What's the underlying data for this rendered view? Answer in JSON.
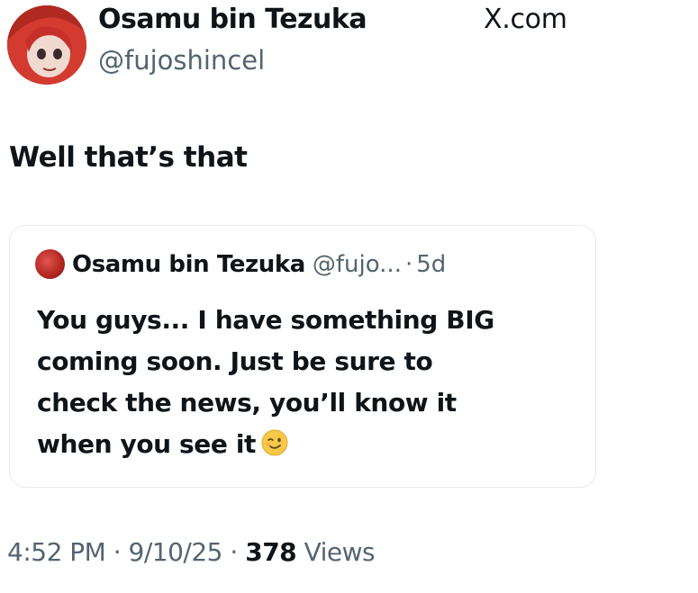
{
  "post": {
    "author_name": "Osamu bin Tezuka",
    "author_handle": "@fujoshincel",
    "site": "X.com",
    "text": "Well that’s that"
  },
  "quote": {
    "author_name": "Osamu bin Tezuka",
    "author_handle": "@fujo...",
    "separator": "·",
    "time": "5d",
    "lines": [
      "You guys... I have something BIG",
      "coming soon. Just be sure to",
      "check the news, you’ll know it",
      "when you see it"
    ],
    "emoji": "winking-face-icon"
  },
  "meta": {
    "time": "4:52 PM",
    "sep1": "·",
    "date": "9/10/25",
    "sep2": "·",
    "views_count": "378",
    "views_label": "Views"
  },
  "colors": {
    "text_primary": "#0f1419",
    "text_secondary": "#536471",
    "card_border": "#e8ecef",
    "avatar_red": "#d9382f"
  }
}
